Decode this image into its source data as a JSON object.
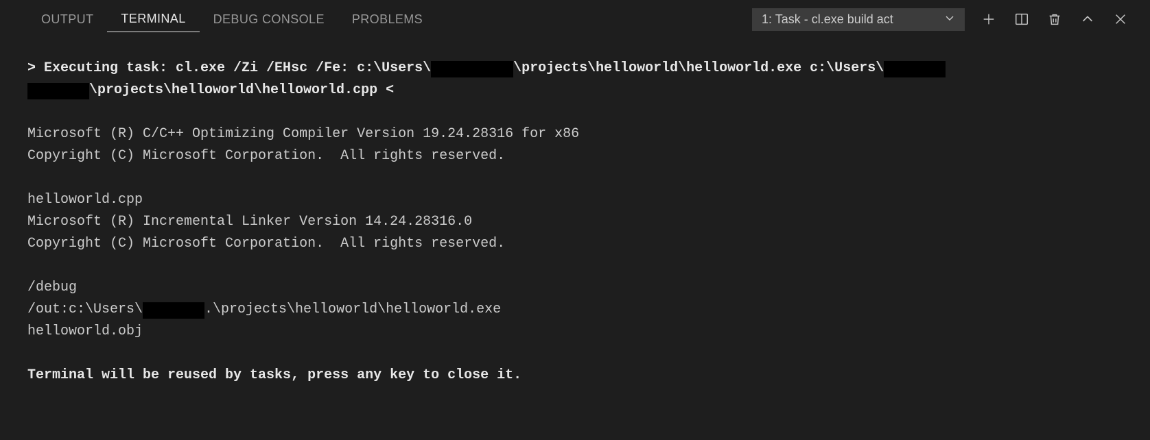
{
  "tabs": {
    "output": "OUTPUT",
    "terminal": "TERMINAL",
    "debug_console": "DEBUG CONSOLE",
    "problems": "PROBLEMS"
  },
  "toolbar": {
    "task_selector": "1: Task - cl.exe build act"
  },
  "terminal": {
    "exec_prefix": "> Executing task: cl.exe /Zi /EHsc /Fe: c:\\Users\\",
    "exec_mid": "\\projects\\helloworld\\helloworld.exe c:\\Users\\",
    "exec_tail": "\\projects\\helloworld\\helloworld.cpp <",
    "compiler1": "Microsoft (R) C/C++ Optimizing Compiler Version 19.24.28316 for x86",
    "copyright": "Copyright (C) Microsoft Corporation.  All rights reserved.",
    "srcfile": "helloworld.cpp",
    "linker": "Microsoft (R) Incremental Linker Version 14.24.28316.0",
    "debug_flag": "/debug",
    "out_prefix": "/out:c:\\Users\\",
    "out_suffix": ".\\projects\\helloworld\\helloworld.exe",
    "objfile": "helloworld.obj",
    "reuse": "Terminal will be reused by tasks, press any key to close it."
  }
}
